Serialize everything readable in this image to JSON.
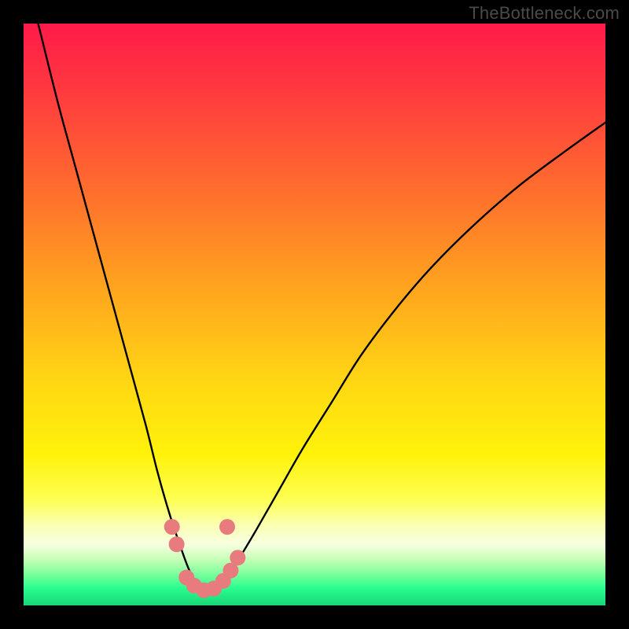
{
  "watermark": "TheBottleneck.com",
  "colors": {
    "frame": "#000000",
    "curve": "#000000",
    "marker": "#e77b7e",
    "gradient_stops": [
      {
        "offset": 0.0,
        "color": "#ff1a49"
      },
      {
        "offset": 0.12,
        "color": "#ff3b3f"
      },
      {
        "offset": 0.28,
        "color": "#ff6b2e"
      },
      {
        "offset": 0.45,
        "color": "#ffa31e"
      },
      {
        "offset": 0.62,
        "color": "#ffd813"
      },
      {
        "offset": 0.74,
        "color": "#fff20a"
      },
      {
        "offset": 0.82,
        "color": "#fdff55"
      },
      {
        "offset": 0.86,
        "color": "#fbffb0"
      },
      {
        "offset": 0.895,
        "color": "#f6ffe0"
      },
      {
        "offset": 0.92,
        "color": "#c9ffb8"
      },
      {
        "offset": 0.945,
        "color": "#7fff9d"
      },
      {
        "offset": 0.97,
        "color": "#2bfd8e"
      },
      {
        "offset": 1.0,
        "color": "#17d678"
      }
    ]
  },
  "chart_data": {
    "type": "line",
    "title": "",
    "xlabel": "",
    "ylabel": "",
    "xlim": [
      0,
      100
    ],
    "ylim": [
      0,
      100
    ],
    "series": [
      {
        "name": "bottleneck-curve",
        "x": [
          0,
          3,
          6,
          9,
          12,
          15,
          18,
          21,
          23,
          25,
          27,
          28.5,
          30,
          31.5,
          33,
          35,
          37,
          40,
          44,
          48,
          53,
          58,
          64,
          70,
          77,
          85,
          93,
          100
        ],
        "y": [
          110,
          98,
          86,
          75,
          64,
          53,
          42,
          31,
          23,
          16,
          10,
          6,
          3.5,
          2.5,
          3,
          5,
          8,
          13,
          20,
          27,
          35,
          43,
          51,
          58,
          65,
          72,
          78,
          83
        ]
      }
    ],
    "markers": [
      {
        "x": 25.5,
        "y": 13.5
      },
      {
        "x": 26.3,
        "y": 10.5
      },
      {
        "x": 28.0,
        "y": 4.8
      },
      {
        "x": 29.3,
        "y": 3.4
      },
      {
        "x": 31.0,
        "y": 2.6
      },
      {
        "x": 32.7,
        "y": 2.9
      },
      {
        "x": 34.3,
        "y": 4.2
      },
      {
        "x": 35.6,
        "y": 6.0
      },
      {
        "x": 36.8,
        "y": 8.2
      },
      {
        "x": 35.0,
        "y": 13.5
      }
    ],
    "grid": false,
    "legend": false
  }
}
